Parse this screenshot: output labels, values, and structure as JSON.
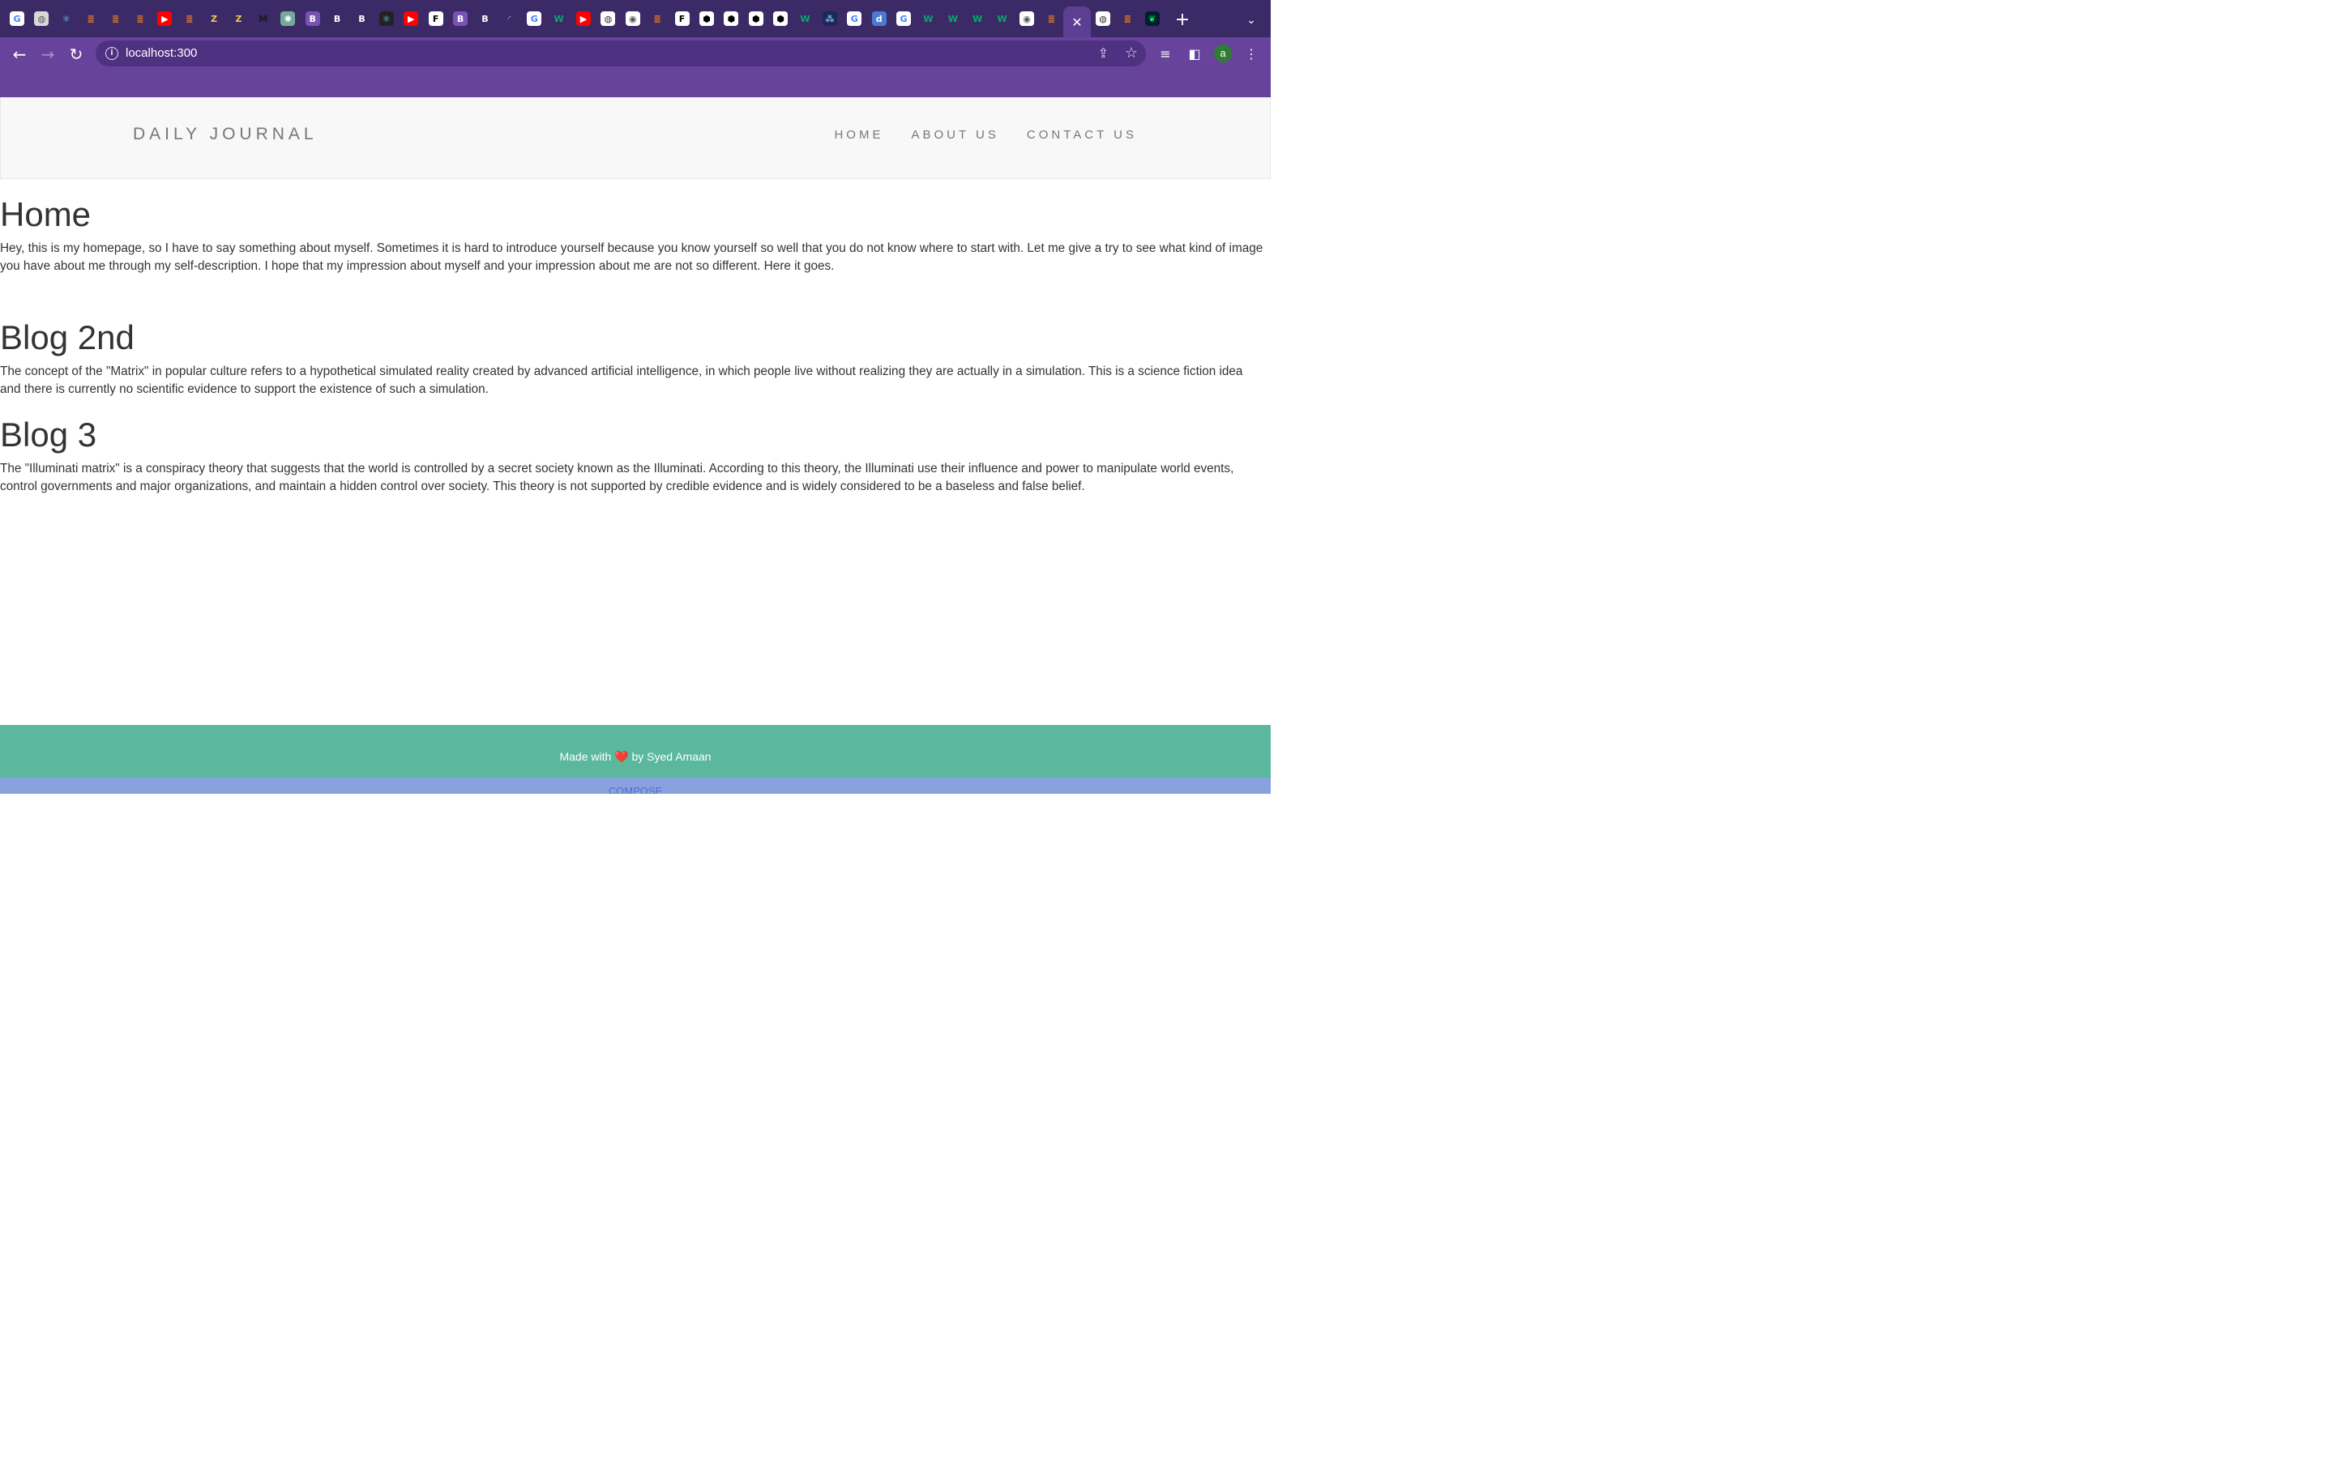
{
  "browser": {
    "tab_favicons": [
      {
        "name": "google-icon",
        "bg": "#ffffff",
        "glyph": "G",
        "color": "#4285f4"
      },
      {
        "name": "globe-icon",
        "bg": "#d8d8d8",
        "glyph": "◍",
        "color": "#555"
      },
      {
        "name": "react-icon",
        "bg": "#3b2a66",
        "glyph": "⚛",
        "color": "#61dafb"
      },
      {
        "name": "stackoverflow-icon",
        "bg": "#3b2a66",
        "glyph": "≣",
        "color": "#f48024"
      },
      {
        "name": "stackoverflow-icon",
        "bg": "#3b2a66",
        "glyph": "≣",
        "color": "#f48024"
      },
      {
        "name": "stackoverflow-icon",
        "bg": "#3b2a66",
        "glyph": "≣",
        "color": "#f48024"
      },
      {
        "name": "youtube-icon",
        "bg": "#ff0000",
        "glyph": "▶",
        "color": "#fff"
      },
      {
        "name": "stackoverflow-icon",
        "bg": "#3b2a66",
        "glyph": "≣",
        "color": "#f48024"
      },
      {
        "name": "zb-icon",
        "bg": "#3b2a66",
        "glyph": "Z",
        "color": "#f2c94c"
      },
      {
        "name": "zb-icon",
        "bg": "#3b2a66",
        "glyph": "Z",
        "color": "#f2c94c"
      },
      {
        "name": "medium-icon",
        "bg": "#3b2a66",
        "glyph": "M",
        "color": "#1a1a1a"
      },
      {
        "name": "chatgpt-icon",
        "bg": "#74aa9c",
        "glyph": "✺",
        "color": "#fff"
      },
      {
        "name": "bootstrap-icon",
        "bg": "#7952b3",
        "glyph": "B",
        "color": "#fff"
      },
      {
        "name": "bootstrap-icon",
        "bg": "#3b2a66",
        "glyph": "B",
        "color": "#fff"
      },
      {
        "name": "bootstrap-icon",
        "bg": "#3b2a66",
        "glyph": "B",
        "color": "#fff"
      },
      {
        "name": "react-icon",
        "bg": "#222",
        "glyph": "⚛",
        "color": "#61dafb"
      },
      {
        "name": "youtube-icon",
        "bg": "#ff0000",
        "glyph": "▶",
        "color": "#fff"
      },
      {
        "name": "framer-icon",
        "bg": "#ffffff",
        "glyph": "F",
        "color": "#000"
      },
      {
        "name": "bootstrap-icon",
        "bg": "#7952b3",
        "glyph": "B",
        "color": "#fff"
      },
      {
        "name": "bootstrap-icon",
        "bg": "#3b2a66",
        "glyph": "B",
        "color": "#fff"
      },
      {
        "name": "loading-icon",
        "bg": "#3b2a66",
        "glyph": "◜",
        "color": "#9aa0ff"
      },
      {
        "name": "google-icon",
        "bg": "#ffffff",
        "glyph": "G",
        "color": "#4285f4"
      },
      {
        "name": "w3schools-icon",
        "bg": "#3b2a66",
        "glyph": "W",
        "color": "#04aa6d"
      },
      {
        "name": "youtube-icon",
        "bg": "#ff0000",
        "glyph": "▶",
        "color": "#fff"
      },
      {
        "name": "globe-icon",
        "bg": "#ffffff",
        "glyph": "◍",
        "color": "#333"
      },
      {
        "name": "chrome-icon",
        "bg": "#ffffff",
        "glyph": "◉",
        "color": "#555"
      },
      {
        "name": "stackoverflow-icon",
        "bg": "#3b2a66",
        "glyph": "≣",
        "color": "#f48024"
      },
      {
        "name": "framer-icon",
        "bg": "#ffffff",
        "glyph": "F",
        "color": "#000"
      },
      {
        "name": "codepen-icon",
        "bg": "#ffffff",
        "glyph": "⬢",
        "color": "#000"
      },
      {
        "name": "codepen-icon",
        "bg": "#ffffff",
        "glyph": "⬢",
        "color": "#000"
      },
      {
        "name": "codepen-icon",
        "bg": "#ffffff",
        "glyph": "⬢",
        "color": "#000"
      },
      {
        "name": "codepen-icon",
        "bg": "#ffffff",
        "glyph": "⬢",
        "color": "#000"
      },
      {
        "name": "w3schools-icon",
        "bg": "#3b2a66",
        "glyph": "W",
        "color": "#04aa6d"
      },
      {
        "name": "app-icon",
        "bg": "#1a2a55",
        "glyph": "⁂",
        "color": "#8ab4f8"
      },
      {
        "name": "google-icon",
        "bg": "#ffffff",
        "glyph": "G",
        "color": "#4285f4"
      },
      {
        "name": "d-icon",
        "bg": "#4a7bd0",
        "glyph": "d",
        "color": "#fff"
      },
      {
        "name": "google-icon",
        "bg": "#ffffff",
        "glyph": "G",
        "color": "#4285f4"
      },
      {
        "name": "w3schools-icon",
        "bg": "#3b2a66",
        "glyph": "W",
        "color": "#04aa6d"
      },
      {
        "name": "w3schools-icon",
        "bg": "#3b2a66",
        "glyph": "W",
        "color": "#04aa6d"
      },
      {
        "name": "w3schools-icon",
        "bg": "#3b2a66",
        "glyph": "W",
        "color": "#04aa6d"
      },
      {
        "name": "w3schools-icon",
        "bg": "#3b2a66",
        "glyph": "W",
        "color": "#04aa6d"
      },
      {
        "name": "chrome-icon",
        "bg": "#ffffff",
        "glyph": "◉",
        "color": "#555"
      },
      {
        "name": "stackoverflow-icon",
        "bg": "#3b2a66",
        "glyph": "≣",
        "color": "#f48024"
      }
    ],
    "active_tab_glyph": "✕",
    "after_active_favicons": [
      {
        "name": "globe-icon",
        "bg": "#ffffff",
        "glyph": "◍",
        "color": "#333"
      },
      {
        "name": "stackoverflow-icon",
        "bg": "#3b2a66",
        "glyph": "≣",
        "color": "#f48024"
      },
      {
        "name": "mongodb-icon",
        "bg": "#001e2b",
        "glyph": "❦",
        "color": "#00ed64"
      }
    ],
    "new_tab_glyph": "+",
    "tab_overflow_glyph": "⌄",
    "back_glyph": "←",
    "forward_glyph": "→",
    "reload_glyph": "↻",
    "info_glyph": "i",
    "url": "localhost:300",
    "share_glyph": "⇪",
    "star_glyph": "☆",
    "media_glyph": "≡",
    "sidepanel_glyph": "◧",
    "profile_initial": "a",
    "menu_glyph": "⋮"
  },
  "page": {
    "brand": "DAILY JOURNAL",
    "nav": {
      "home": "HOME",
      "about": "ABOUT US",
      "contact": "CONTACT US"
    },
    "posts": [
      {
        "title": "Home",
        "body": "Hey, this is my homepage, so I have to say something about myself. Sometimes it is hard to introduce yourself because you know yourself so well that you do not know where to start with. Let me give a try to see what kind of image you have about me through my self-description. I hope that my impression about myself and your impression about me are not so different. Here it goes."
      },
      {
        "title": "Blog 2nd",
        "body": "The concept of the \"Matrix\" in popular culture refers to a hypothetical simulated reality created by advanced artificial intelligence, in which people live without realizing they are actually in a simulation. This is a science fiction idea and there is currently no scientific evidence to support the existence of such a simulation."
      },
      {
        "title": "Blog 3",
        "body": "The \"Illuminati matrix\" is a conspiracy theory that suggests that the world is controlled by a secret society known as the Illuminati. According to this theory, the Illuminati use their influence and power to manipulate world events, control governments and major organizations, and maintain a hidden control over society. This theory is not supported by credible evidence and is widely considered to be a baseless and false belief."
      }
    ],
    "footer": {
      "prefix": "Made with",
      "heart": "❤️",
      "suffix": "by Syed Amaan"
    },
    "compose_label": "COMPOSE"
  },
  "colors": {
    "tabstrip": "#3b2a66",
    "toolbar": "#68439b",
    "footer": "#5bb89e",
    "compose_bar": "#8aa1e0"
  }
}
